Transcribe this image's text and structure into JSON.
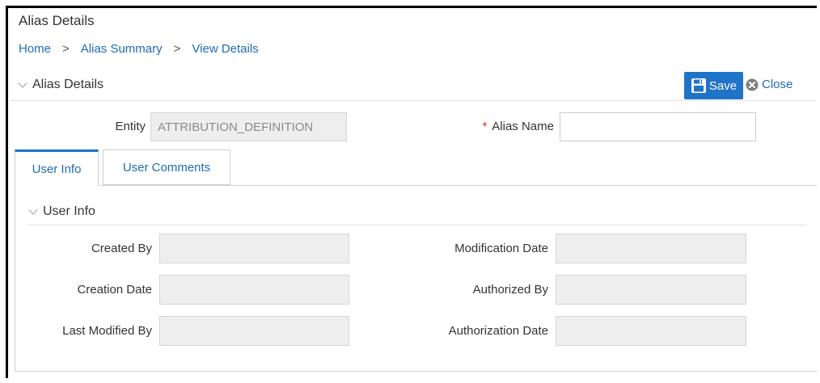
{
  "page": {
    "title": "Alias Details"
  },
  "breadcrumb": {
    "items": [
      "Home",
      "Alias Summary",
      "View Details"
    ],
    "separator": ">"
  },
  "section": {
    "title": "Alias Details"
  },
  "toolbar": {
    "save_label": "Save",
    "close_label": "Close",
    "save_color": "#1f73c8"
  },
  "form": {
    "entity_label": "Entity",
    "entity_value": "ATTRIBUTION_DEFINITION",
    "alias_name_label": "Alias Name",
    "alias_name_required_mark": "*",
    "alias_name_value": ""
  },
  "tabs": [
    {
      "label": "User Info",
      "active": true
    },
    {
      "label": "User Comments",
      "active": false
    }
  ],
  "user_info": {
    "title": "User Info",
    "fields": {
      "created_by": {
        "label": "Created By",
        "value": ""
      },
      "creation_date": {
        "label": "Creation Date",
        "value": ""
      },
      "last_modified_by": {
        "label": "Last Modified By",
        "value": ""
      },
      "modification_date": {
        "label": "Modification Date",
        "value": ""
      },
      "authorized_by": {
        "label": "Authorized By",
        "value": ""
      },
      "authorization_date": {
        "label": "Authorization Date",
        "value": ""
      }
    }
  },
  "icons": {
    "save": "floppy-disk-icon",
    "close": "close-circle-icon",
    "collapse": "chevron-down-icon"
  }
}
